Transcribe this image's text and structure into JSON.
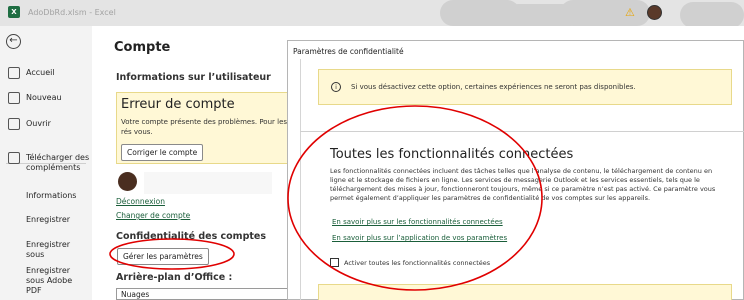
{
  "titlebar": {
    "app_icon": "excel-icon",
    "file_name": "AdoDbRd.xlsm",
    "separator": "-",
    "app_name": "Excel",
    "warning_icon": "warning-icon"
  },
  "nav": {
    "items": [
      {
        "label": "Accueil",
        "icon": "home-icon"
      },
      {
        "label": "Nouveau",
        "icon": "new-file-icon"
      },
      {
        "label": "Ouvrir",
        "icon": "open-folder-icon"
      },
      {
        "label": "Télécharger des compléments",
        "icon": "addins-icon"
      }
    ],
    "plain_items": [
      "Informations",
      "Enregistrer",
      "Enregistrer sous",
      "Enregistrer sous Adobe PDF"
    ]
  },
  "main": {
    "page_title": "Compte",
    "user_info_title": "Informations sur l’utilisateur",
    "error_title": "Erreur de compte",
    "error_text": "Votre compte présente des problèmes. Pour les rés vous.",
    "fix_button": "Corriger le compte",
    "logout_link": "Déconnexion",
    "switch_account_link": "Changer de compte",
    "privacy_title": "Confidentialité des comptes",
    "manage_button": "Gérer les paramètres",
    "background_title": "Arrière-plan d’Office :",
    "background_value": "Nuages"
  },
  "dialog": {
    "title": "Paramètres de confidentialité",
    "info_text": "Si vous désactivez cette option, certaines expériences ne seront pas disponibles.",
    "connected_title": "Toutes les fonctionnalités connectées",
    "connected_desc": "Les fonctionnalités connectées incluent des tâches telles que l’analyse de contenu, le téléchargement de contenu en ligne et le stockage de fichiers en ligne. Les services de messagerie Outlook et les services essentiels, tels que le téléchargement des mises à jour, fonctionneront toujours, même si ce paramètre n’est pas activé. Ce paramètre vous permet également d’appliquer les paramètres de confidentialité de vos comptes sur les appareils.",
    "link_features": "En savoir plus sur les fonctionnalités connectées",
    "link_application": "En savoir plus sur l’application de vos paramètres",
    "checkbox_label": "Activer toutes les fonctionnalités connectées",
    "checkbox_checked": false
  },
  "colors": {
    "accent": "#1a5e3a",
    "warning_bg": "#fff8d6",
    "annotation": "#e00000"
  }
}
